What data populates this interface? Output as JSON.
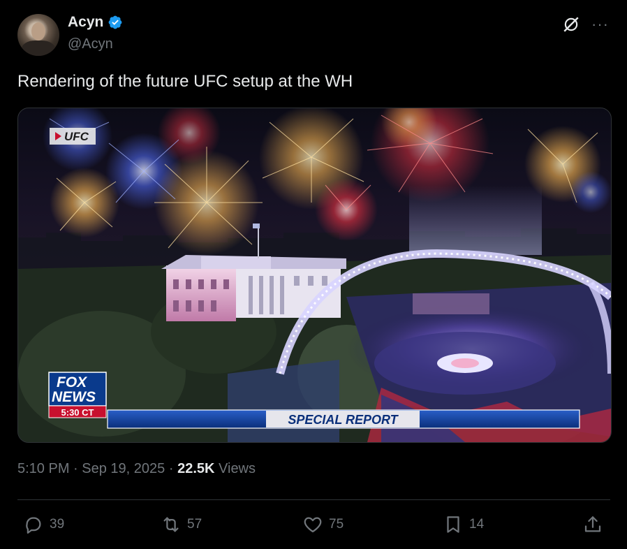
{
  "author": {
    "name": "Acyn",
    "handle": "@Acyn",
    "verified": true,
    "verified_color": "#1d9bf0"
  },
  "tweet": {
    "text": "Rendering of the future UFC setup at the WH"
  },
  "media": {
    "ufc_tag": "UFC",
    "network_logo_line1": "FOX",
    "network_logo_line2": "NEWS",
    "broadcast_time": "5:30 CT",
    "banner_text": "SPECIAL REPORT"
  },
  "meta": {
    "time": "5:10 PM",
    "separator": "·",
    "date": "Sep 19, 2025",
    "views_count": "22.5K",
    "views_label": "Views"
  },
  "actions": {
    "replies": "39",
    "reposts": "57",
    "likes": "75",
    "bookmarks": "14"
  },
  "icons": [
    "verified-badge-icon",
    "grok-icon",
    "more-icon",
    "reply-icon",
    "repost-icon",
    "like-icon",
    "bookmark-icon",
    "share-icon",
    "ufc-play-icon"
  ],
  "colors": {
    "background": "#000000",
    "text": "#e7e9ea",
    "secondary": "#71767b",
    "border": "#2f3336",
    "fox_blue": "#0a3a8c",
    "fox_red": "#c8102e"
  }
}
